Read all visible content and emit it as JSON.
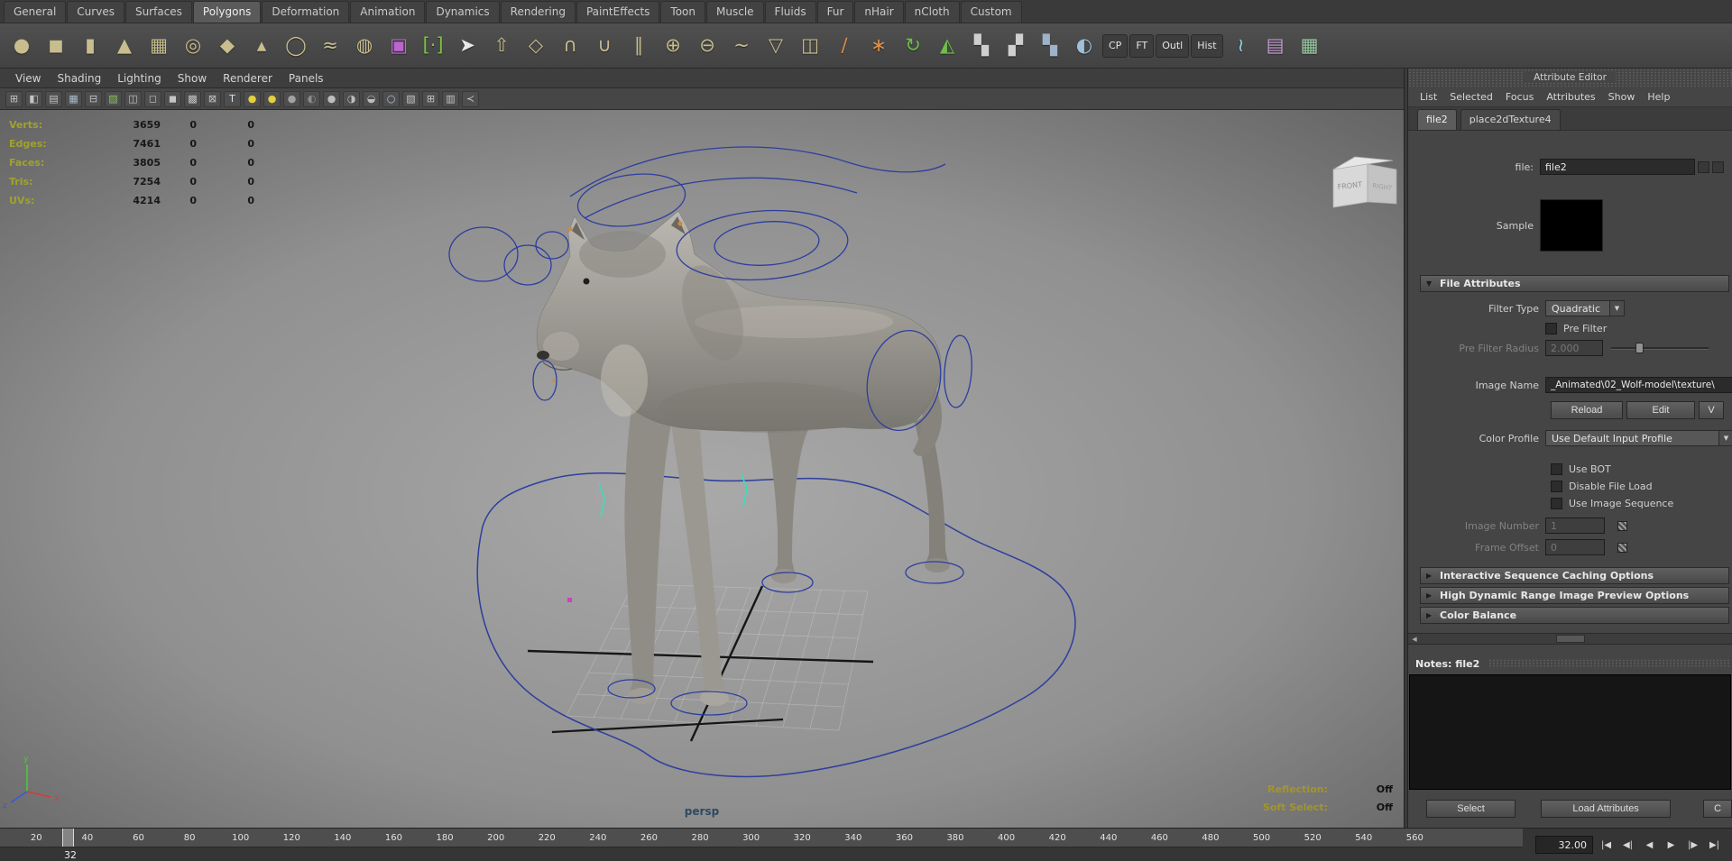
{
  "icons": {
    "expanded_arrow": "▼",
    "collapsed_arrow": "▶",
    "dropdown_arrow": "▼",
    "left_arrow": "◀"
  },
  "shelf_tabs": {
    "items": [
      {
        "label": "General"
      },
      {
        "label": "Curves"
      },
      {
        "label": "Surfaces"
      },
      {
        "label": "Polygons",
        "active": true
      },
      {
        "label": "Deformation"
      },
      {
        "label": "Animation"
      },
      {
        "label": "Dynamics"
      },
      {
        "label": "Rendering"
      },
      {
        "label": "PaintEffects"
      },
      {
        "label": "Toon"
      },
      {
        "label": "Muscle"
      },
      {
        "label": "Fluids"
      },
      {
        "label": "Fur"
      },
      {
        "label": "nHair"
      },
      {
        "label": "nCloth"
      },
      {
        "label": "Custom"
      }
    ]
  },
  "shelf": {
    "icons": [
      {
        "name": "poly-sphere-icon",
        "glyph": "●",
        "color": "#c7bd8e"
      },
      {
        "name": "poly-cube-icon",
        "glyph": "◼",
        "color": "#c7bd8e"
      },
      {
        "name": "poly-cylinder-icon",
        "glyph": "▮",
        "color": "#c7bd8e"
      },
      {
        "name": "poly-cone-icon",
        "glyph": "▲",
        "color": "#c7bd8e"
      },
      {
        "name": "poly-plane-icon",
        "glyph": "▦",
        "color": "#c7bd8e"
      },
      {
        "name": "poly-torus-icon",
        "glyph": "◎",
        "color": "#c7bd8e"
      },
      {
        "name": "poly-prism-icon",
        "glyph": "◆",
        "color": "#c7bd8e"
      },
      {
        "name": "poly-pyramid-icon",
        "glyph": "▴",
        "color": "#c7bd8e"
      },
      {
        "name": "poly-pipe-icon",
        "glyph": "◯",
        "color": "#c7bd8e"
      },
      {
        "name": "poly-helix-icon",
        "glyph": "≈",
        "color": "#c7bd8e"
      },
      {
        "name": "poly-soccer-ball-icon",
        "glyph": "◍",
        "color": "#c7bd8e"
      },
      {
        "name": "sculpt-geometry-icon",
        "glyph": "▣",
        "color": "#bb66cc"
      },
      {
        "name": "paint-select-tool-icon",
        "glyph": "[·]",
        "color": "#7cc143"
      },
      {
        "name": "select-arrow-icon",
        "glyph": "➤",
        "color": "#e8e8e8"
      },
      {
        "name": "extrude-icon",
        "glyph": "⇧",
        "color": "#c7bd8e"
      },
      {
        "name": "bevel-icon",
        "glyph": "◇",
        "color": "#c7bd8e"
      },
      {
        "name": "bridge-icon",
        "glyph": "∩",
        "color": "#c7bd8e"
      },
      {
        "name": "combine-icon",
        "glyph": "∪",
        "color": "#c7bd8e"
      },
      {
        "name": "separate-icon",
        "glyph": "∥",
        "color": "#c7bd8e"
      },
      {
        "name": "boolean-union-icon",
        "glyph": "⊕",
        "color": "#c7bd8e"
      },
      {
        "name": "boolean-difference-icon",
        "glyph": "⊖",
        "color": "#c7bd8e"
      },
      {
        "name": "smooth-icon",
        "glyph": "~",
        "color": "#c7bd8e"
      },
      {
        "name": "reduce-icon",
        "glyph": "▽",
        "color": "#c7bd8e"
      },
      {
        "name": "mirror-geometry-icon",
        "glyph": "◫",
        "color": "#c7bd8e"
      },
      {
        "name": "split-polygon-icon",
        "glyph": "∕",
        "color": "#d98f4a"
      },
      {
        "name": "merge-vertices-icon",
        "glyph": "∗",
        "color": "#d98f4a"
      },
      {
        "name": "spin-edge-icon",
        "glyph": "↻",
        "color": "#6fbf4a"
      },
      {
        "name": "flip-triangle-icon",
        "glyph": "◭",
        "color": "#6fbf4a"
      },
      {
        "name": "checker-a-icon",
        "glyph": "▚",
        "color": "#cfcfcf"
      },
      {
        "name": "checker-b-icon",
        "glyph": "▞",
        "color": "#cfcfcf"
      },
      {
        "name": "checker-c-icon",
        "glyph": "▚",
        "color": "#9fb2c9"
      },
      {
        "name": "render-view-icon",
        "glyph": "◐",
        "color": "#9fc0d8"
      },
      {
        "name": "cp-shelf-button",
        "glyph": "CP",
        "color": "#e4e4e4",
        "kind": "text"
      },
      {
        "name": "ft-shelf-button",
        "glyph": "FT",
        "color": "#e4e4e4",
        "kind": "text"
      },
      {
        "name": "outliner-shelf-button",
        "glyph": "Outl",
        "color": "#e4e4e4",
        "kind": "text"
      },
      {
        "name": "history-shelf-button",
        "glyph": "Hist",
        "color": "#e4e4e4",
        "kind": "text"
      },
      {
        "name": "graph-editor-icon",
        "glyph": "≀",
        "color": "#8fd0e8"
      },
      {
        "name": "hypershade-icon",
        "glyph": "▤",
        "color": "#c9a0d8"
      },
      {
        "name": "uv-texture-editor-icon",
        "glyph": "▦",
        "color": "#9fd0a8"
      }
    ]
  },
  "viewport": {
    "menus": [
      "View",
      "Shading",
      "Lighting",
      "Show",
      "Renderer",
      "Panels"
    ],
    "toolbar_icons": [
      {
        "name": "select-camera-icon",
        "glyph": "⊞",
        "color": "#c4c4c4"
      },
      {
        "name": "lock-camera-icon",
        "glyph": "◧",
        "color": "#c4c4c4"
      },
      {
        "name": "bookmark-icon",
        "glyph": "▤",
        "color": "#c4c4c4"
      },
      {
        "name": "image-plane-icon",
        "glyph": "▦",
        "color": "#a8bccb"
      },
      {
        "name": "2d-pan-zoom-icon",
        "glyph": "⊟",
        "color": "#c4c4c4"
      },
      {
        "name": "grease-pencil-icon",
        "glyph": "▨",
        "color": "#8cc45c"
      },
      {
        "name": "film-gate-icon",
        "glyph": "◫",
        "color": "#c4c4c4"
      },
      {
        "name": "resolution-gate-icon",
        "glyph": "◻",
        "color": "#c4c4c4"
      },
      {
        "name": "gate-mask-icon",
        "glyph": "◼",
        "color": "#c4c4c4"
      },
      {
        "name": "field-chart-icon",
        "glyph": "▩",
        "color": "#c4c4c4"
      },
      {
        "name": "safe-action-icon",
        "glyph": "⊠",
        "color": "#c4c4c4"
      },
      {
        "name": "safe-title-icon",
        "glyph": "T",
        "color": "#cfe0ef"
      },
      {
        "name": "default-light-icon",
        "glyph": "●",
        "color": "#e3cf3f"
      },
      {
        "name": "all-lights-icon",
        "glyph": "●",
        "color": "#e3cf3f"
      },
      {
        "name": "no-lights-icon",
        "glyph": "●",
        "color": "#a2a2a2"
      },
      {
        "name": "shadows-icon",
        "glyph": "◐",
        "color": "#8c8c8c"
      },
      {
        "name": "shaded-display-icon",
        "glyph": "●",
        "color": "#bdbdbd"
      },
      {
        "name": "textured-display-icon",
        "glyph": "◑",
        "color": "#bdbdbd"
      },
      {
        "name": "default-material-icon",
        "glyph": "◒",
        "color": "#bdbdbd"
      },
      {
        "name": "xray-icon",
        "glyph": "○",
        "color": "#b7c6d2"
      },
      {
        "name": "isolate-select-icon",
        "glyph": "▧",
        "color": "#c4c4c4"
      },
      {
        "name": "pane-layout-icon",
        "glyph": "⊞",
        "color": "#c4c4c4"
      },
      {
        "name": "outliner-toggle-icon",
        "glyph": "▥",
        "color": "#c4c4c4"
      },
      {
        "name": "share-view-icon",
        "glyph": "≺",
        "color": "#c4c4c4"
      }
    ],
    "hud_rows": [
      {
        "label": "Verts:",
        "c1": "3659",
        "c2": "0",
        "c3": "0"
      },
      {
        "label": "Edges:",
        "c1": "7461",
        "c2": "0",
        "c3": "0"
      },
      {
        "label": "Faces:",
        "c1": "3805",
        "c2": "0",
        "c3": "0"
      },
      {
        "label": "Tris:",
        "c1": "7254",
        "c2": "0",
        "c3": "0"
      },
      {
        "label": "UVs:",
        "c1": "4214",
        "c2": "0",
        "c3": "0"
      }
    ],
    "camera": "persp",
    "view_cube": {
      "front": "FRONT",
      "right": "RIGHT"
    },
    "axis": {
      "x": "x",
      "y": "y",
      "z": "z"
    },
    "status": [
      {
        "label": "Reflection:",
        "value": "Off"
      },
      {
        "label": "Soft Select:",
        "value": "Off"
      }
    ]
  },
  "attribute_editor": {
    "title": "Attribute Editor",
    "menu": [
      "List",
      "Selected",
      "Focus",
      "Attributes",
      "Show",
      "Help"
    ],
    "tabs": [
      {
        "label": "file2",
        "active": true
      },
      {
        "label": "place2dTexture4"
      }
    ],
    "file_label": "file:",
    "file_value": "file2",
    "sample_label": "Sample",
    "file_attributes": {
      "title": "File Attributes",
      "filter_type_label": "Filter Type",
      "filter_type_value": "Quadratic",
      "pre_filter_label": "Pre Filter",
      "pre_filter_radius_label": "Pre Filter Radius",
      "pre_filter_radius_value": "2.000",
      "image_name_label": "Image Name",
      "image_name_value": "_Animated\\02_Wolf-model\\texture\\",
      "reload_button": "Reload",
      "edit_button": "Edit",
      "view_button": "V",
      "color_profile_label": "Color Profile",
      "color_profile_value": "Use Default Input Profile",
      "use_bot_label": "Use BOT",
      "disable_file_load_label": "Disable File Load",
      "use_image_sequence_label": "Use Image Sequence",
      "image_number_label": "Image Number",
      "image_number_value": "1",
      "frame_offset_label": "Frame Offset",
      "frame_offset_value": "0"
    },
    "collapsed_sections": [
      {
        "label": "Interactive Sequence Caching Options"
      },
      {
        "label": "High Dynamic Range Image Preview Options"
      },
      {
        "label": "Color Balance"
      }
    ],
    "notes_label": "Notes: file2",
    "select_button": "Select",
    "load_attributes_button": "Load Attributes",
    "copy_button": "C"
  },
  "timeline": {
    "ticks": [
      "20",
      "40",
      "60",
      "80",
      "100",
      "120",
      "140",
      "160",
      "180",
      "200",
      "220",
      "240",
      "260",
      "280",
      "300",
      "320",
      "340",
      "360",
      "380",
      "400",
      "420",
      "440",
      "460",
      "480",
      "500",
      "520",
      "540",
      "560"
    ],
    "current_frame": "32",
    "time_field": "32.00",
    "playback": [
      {
        "name": "go-to-start-button",
        "glyph": "|◀"
      },
      {
        "name": "step-back-button",
        "glyph": "◀|"
      },
      {
        "name": "play-backwards-button",
        "glyph": "◀"
      },
      {
        "name": "play-forwards-button",
        "glyph": "▶"
      },
      {
        "name": "step-forward-button",
        "glyph": "|▶"
      },
      {
        "name": "go-to-end-button",
        "glyph": "▶|"
      }
    ]
  }
}
